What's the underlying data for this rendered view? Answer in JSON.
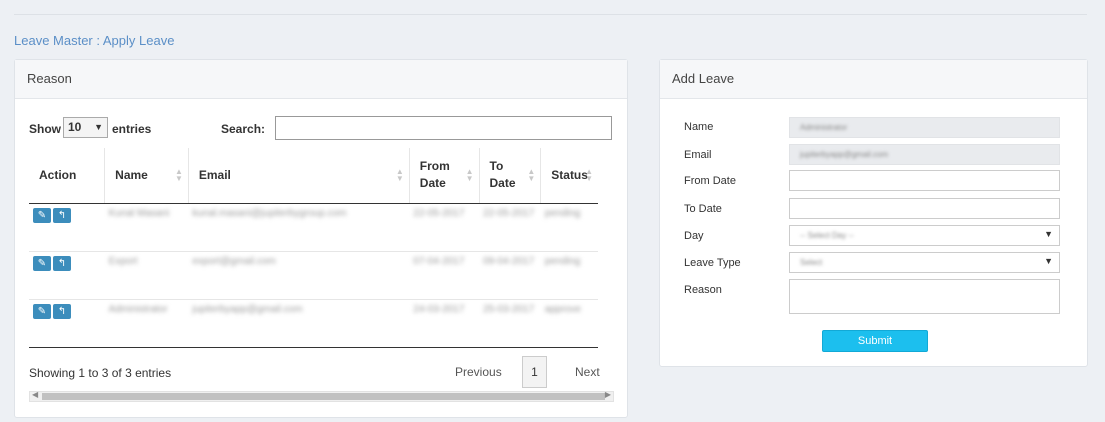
{
  "breadcrumb": "Leave Master : Apply Leave",
  "left_panel": {
    "title": "Reason",
    "show_label": "Show",
    "entries_value": "10",
    "entries_label": "entries",
    "search_label": "Search:",
    "columns": [
      "Action",
      "Name",
      "Email",
      "From Date",
      "To Date",
      "Status"
    ],
    "rows": [
      {
        "name": "Kunal Masani",
        "email": "kunal.masani@jupiterbygroup.com",
        "from": "22-05-2017",
        "to": "22-05-2017",
        "status": "pending"
      },
      {
        "name": "Export",
        "email": "export@gmail.com",
        "from": "07-04-2017",
        "to": "09-04-2017",
        "status": "pending"
      },
      {
        "name": "Administrator",
        "email": "jupiterbyapp@gmail.com",
        "from": "24-03-2017",
        "to": "25-03-2017",
        "status": "approve"
      }
    ],
    "info": "Showing 1 to 3 of 3 entries",
    "prev_label": "Previous",
    "current_page": "1",
    "next_label": "Next"
  },
  "right_panel": {
    "title": "Add Leave",
    "labels": {
      "name": "Name",
      "email": "Email",
      "from_date": "From Date",
      "to_date": "To Date",
      "day": "Day",
      "leave_type": "Leave Type",
      "reason": "Reason"
    },
    "name_value": "Administrator",
    "email_value": "jupiterbyapp@gmail.com",
    "day_value": "-- Select Day --",
    "leave_type_value": "Select",
    "submit_label": "Submit"
  },
  "colors": {
    "accent": "#3c8dbc",
    "submit": "#1cbfee",
    "link": "#5b8fc7"
  }
}
